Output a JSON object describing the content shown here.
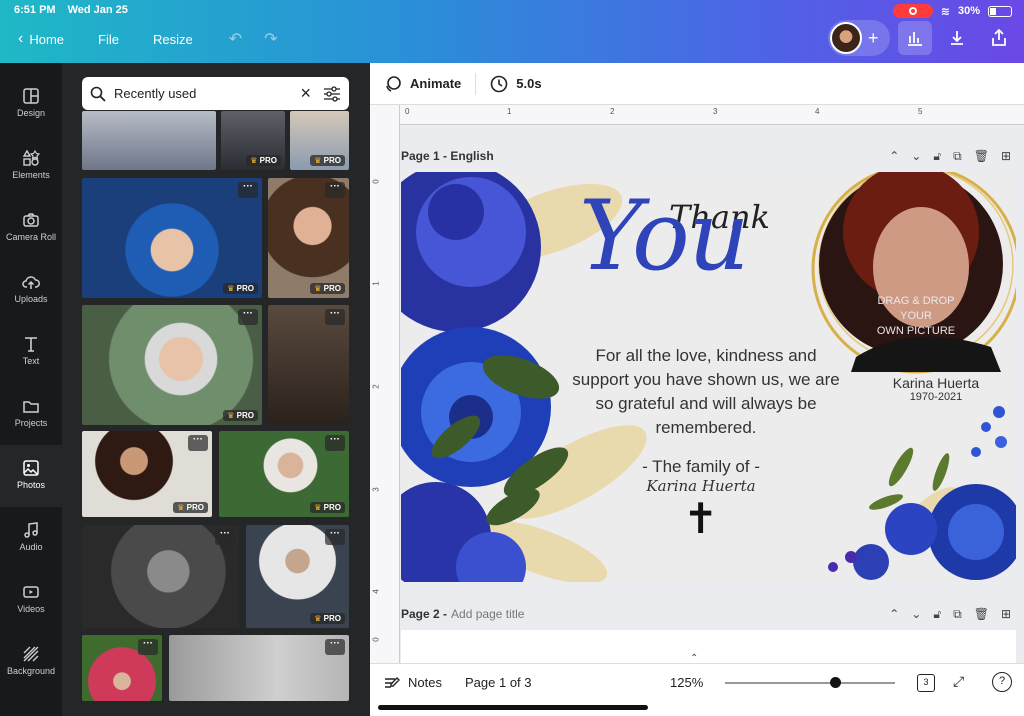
{
  "status": {
    "time": "6:51 PM",
    "date": "Wed Jan 25",
    "battery": "30%"
  },
  "topnav": {
    "back": "‹",
    "home": "Home",
    "file": "File",
    "resize": "Resize"
  },
  "sidebar": {
    "items": [
      {
        "label": "Design",
        "icon": "layout-icon"
      },
      {
        "label": "Elements",
        "icon": "shapes-icon"
      },
      {
        "label": "Camera Roll",
        "icon": "camera-icon"
      },
      {
        "label": "Uploads",
        "icon": "cloud-upload-icon"
      },
      {
        "label": "Text",
        "icon": "text-icon"
      },
      {
        "label": "Projects",
        "icon": "folder-icon"
      },
      {
        "label": "Photos",
        "icon": "image-icon"
      },
      {
        "label": "Audio",
        "icon": "music-icon"
      },
      {
        "label": "Videos",
        "icon": "video-icon"
      },
      {
        "label": "Background",
        "icon": "pattern-icon"
      }
    ]
  },
  "search": {
    "value": "Recently used"
  },
  "photos": {
    "pro_label": "PRO",
    "dots": "···"
  },
  "editor": {
    "animate": "Animate",
    "duration": "5.0s"
  },
  "ruler": {
    "h": [
      "0",
      "1",
      "2",
      "3",
      "4",
      "5"
    ],
    "v": [
      "0",
      "1",
      "2",
      "3",
      "4",
      "0"
    ]
  },
  "pages": [
    {
      "label": "Page 1 - English"
    },
    {
      "label": "Page 2 -",
      "placeholder": "Add page title"
    }
  ],
  "card": {
    "thank": "Thank",
    "you": "You",
    "message": [
      "For all the love, kindness and",
      "support you have shown us, we are",
      "so grateful and will always be",
      "remembered."
    ],
    "family": "- The family of -",
    "family_name": "Karina Huerta",
    "cross": "✝",
    "photo_hint": [
      "DRAG & DROP YOUR",
      "OWN PICTURE"
    ],
    "name": "Karina Huerta",
    "years": "1970-2021"
  },
  "footer": {
    "notes": "Notes",
    "page_status": "Page 1 of 3",
    "zoom": "125%",
    "page_count": "3",
    "help": "?"
  }
}
